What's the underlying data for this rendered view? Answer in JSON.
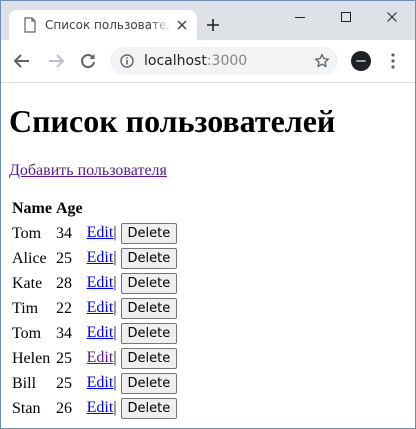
{
  "browser": {
    "tab_title": "Список пользователей",
    "address_host": "localhost",
    "address_port": ":3000"
  },
  "page": {
    "heading": "Список пользователей",
    "add_link": "Добавить пользователя",
    "columns": [
      "Name",
      "Age"
    ],
    "edit_label": "Edit",
    "separator": "|",
    "delete_label": "Delete",
    "users": [
      {
        "name": "Tom",
        "age": "34",
        "edit_visited": false
      },
      {
        "name": "Alice",
        "age": "25",
        "edit_visited": false
      },
      {
        "name": "Kate",
        "age": "28",
        "edit_visited": false
      },
      {
        "name": "Tim",
        "age": "22",
        "edit_visited": false
      },
      {
        "name": "Tom",
        "age": "34",
        "edit_visited": false
      },
      {
        "name": "Helen",
        "age": "25",
        "edit_visited": true
      },
      {
        "name": "Bill",
        "age": "25",
        "edit_visited": false
      },
      {
        "name": "Stan",
        "age": "26",
        "edit_visited": false
      }
    ]
  },
  "icons": {
    "tab_favicon": "page-icon",
    "tab_close": "close-icon",
    "new_tab": "plus-icon",
    "minimize": "minimize-icon",
    "maximize": "maximize-icon",
    "close": "close-icon",
    "back": "arrow-left-icon",
    "forward": "arrow-right-icon",
    "reload": "reload-icon",
    "site_info": "info-icon",
    "bookmark": "star-icon",
    "menu": "more-vert-icon"
  },
  "colors": {
    "titlebar": "#dee1e6",
    "link": "#0000ee",
    "visited_link": "#551a8b"
  }
}
